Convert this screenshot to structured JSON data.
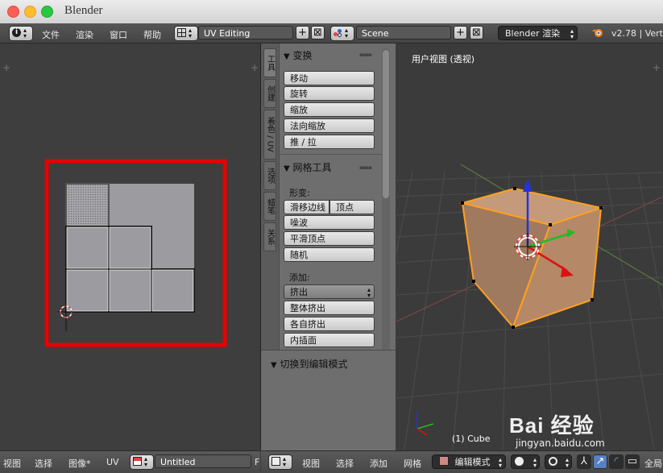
{
  "window": {
    "title": "Blender"
  },
  "infobar": {
    "menus": [
      "文件",
      "渲染",
      "窗口",
      "帮助"
    ],
    "screen_layout": "UV Editing",
    "scene": "Scene",
    "render_engine": "Blender 渲染",
    "version": "v2.78 | Vert"
  },
  "toolshelf": {
    "tabs": [
      "工具",
      "创建",
      "着色 / UV",
      "选项",
      "蜡笔",
      "关系"
    ],
    "transform_panel": {
      "title": "变换",
      "buttons": [
        "移动",
        "旋转",
        "缩放",
        "法向缩放",
        "推 / 拉"
      ]
    },
    "mesh_tools_panel": {
      "title": "网格工具",
      "deform_label": "形变:",
      "slide_edge": "滑移边线",
      "vertex": "顶点",
      "buttons": [
        "噪波",
        "平滑顶点",
        "随机"
      ],
      "add_label": "添加:",
      "extrude": "挤出",
      "add_buttons": [
        "整体挤出",
        "各自挤出",
        "内插面"
      ]
    },
    "operator_panel": {
      "title": "切换到编辑模式"
    }
  },
  "viewport": {
    "label": "用户视图 (透视)",
    "object_label": "(1) Cube"
  },
  "uv_footer": {
    "menus": [
      "视图",
      "选择",
      "图像*",
      "UV"
    ],
    "image_name": "Untitled",
    "image_suffix": "F"
  },
  "view3d_footer": {
    "menus": [
      "视图",
      "选择",
      "添加",
      "网格"
    ],
    "mode": "编辑模式",
    "pivot": "全局"
  },
  "watermark": {
    "brand": "Bai 经验",
    "url": "jingyan.baidu.com"
  },
  "colors": {
    "highlight_box": "#e80000",
    "uv_face": "#9c9ca0",
    "cube_face": "#b58868",
    "selection_edge": "#ffa020"
  }
}
